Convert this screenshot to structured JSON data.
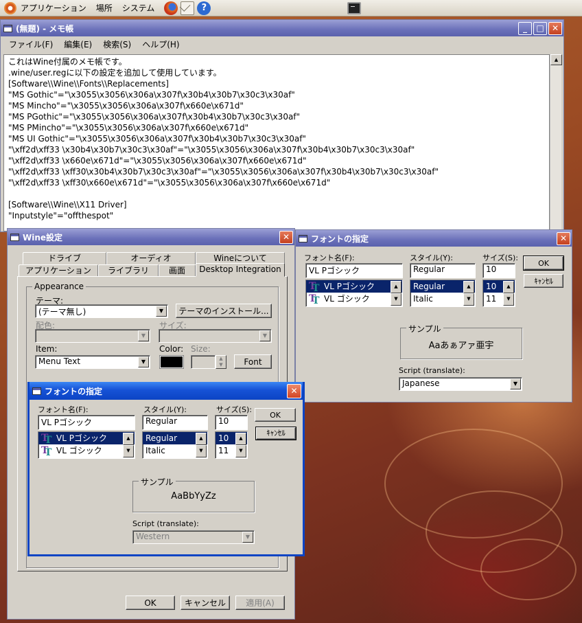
{
  "panel": {
    "menus": [
      "アプリケーション",
      "場所",
      "システム"
    ]
  },
  "notepad": {
    "title": "(無題) - メモ帳",
    "menus": [
      "ファイル(F)",
      "編集(E)",
      "検索(S)",
      "ヘルプ(H)"
    ],
    "lines": [
      "これはWine付属のメモ帳です。",
      ".wine/user.regに以下の設定を追加して使用しています。",
      "[Software\\\\Wine\\\\Fonts\\\\Replacements]",
      "\"MS Gothic\"=\"\\x3055\\x3056\\x306a\\x307f\\x30b4\\x30b7\\x30c3\\x30af\"",
      "\"MS Mincho\"=\"\\x3055\\x3056\\x306a\\x307f\\x660e\\x671d\"",
      "\"MS PGothic\"=\"\\x3055\\x3056\\x306a\\x307f\\x30b4\\x30b7\\x30c3\\x30af\"",
      "\"MS PMincho\"=\"\\x3055\\x3056\\x306a\\x307f\\x660e\\x671d\"",
      "\"MS UI Gothic\"=\"\\x3055\\x3056\\x306a\\x307f\\x30b4\\x30b7\\x30c3\\x30af\"",
      "\"\\xff2d\\xff33 \\x30b4\\x30b7\\x30c3\\x30af\"=\"\\x3055\\x3056\\x306a\\x307f\\x30b4\\x30b7\\x30c3\\x30af\"",
      "\"\\xff2d\\xff33 \\x660e\\x671d\"=\"\\x3055\\x3056\\x306a\\x307f\\x660e\\x671d\"",
      "\"\\xff2d\\xff33 \\xff30\\x30b4\\x30b7\\x30c3\\x30af\"=\"\\x3055\\x3056\\x306a\\x307f\\x30b4\\x30b7\\x30c3\\x30af\"",
      "\"\\xff2d\\xff33 \\xff30\\x660e\\x671d\"=\"\\x3055\\x3056\\x306a\\x307f\\x660e\\x671d\"",
      "",
      "[Software\\\\Wine\\\\X11 Driver]",
      "\"Inputstyle\"=\"offthespot\""
    ]
  },
  "winecfg": {
    "title": "Wine設定",
    "tabs_top": [
      "ドライブ",
      "オーディオ",
      "Wineについて"
    ],
    "tabs_bottom": [
      "アプリケーション",
      "ライブラリ",
      "画面",
      "Desktop Integration"
    ],
    "appearance_label": "Appearance",
    "theme_label": "テーマ:",
    "theme_value": "(テーマ無し)",
    "install_theme": "テーマのインストール...",
    "color_scheme_label": "配色:",
    "size_label": "サイズ:",
    "item_label": "Item:",
    "item_value": "Menu Text",
    "color_label": "Color:",
    "size2_label": "Size:",
    "font_button": "Font",
    "ok": "OK",
    "cancel": "キャンセル",
    "apply": "適用(A)"
  },
  "font_dialog_right": {
    "title": "フォントの指定",
    "font_name_label": "フォント名(F):",
    "style_label": "スタイル(Y):",
    "size_label": "サイズ(S):",
    "font_value": "VL Pゴシック",
    "style_value": "Regular",
    "size_value": "10",
    "fonts": [
      "VL Pゴシック",
      "VL ゴシック"
    ],
    "styles": [
      "Regular",
      "Italic"
    ],
    "sizes": [
      "10",
      "11"
    ],
    "ok": "OK",
    "cancel": "ｷｬﾝｾﾙ",
    "sample_label": "サンプル",
    "sample_text": "Aaあぁアァ亜宇",
    "script_label": "Script (translate):",
    "script_value": "Japanese"
  },
  "font_dialog_left": {
    "title": "フォントの指定",
    "font_name_label": "フォント名(F):",
    "style_label": "スタイル(Y):",
    "size_label": "サイズ(S):",
    "font_value": "VL Pゴシック",
    "style_value": "Regular",
    "size_value": "10",
    "fonts": [
      "VL Pゴシック",
      "VL ゴシック"
    ],
    "styles": [
      "Regular",
      "Italic"
    ],
    "sizes": [
      "10",
      "11"
    ],
    "ok": "OK",
    "cancel": "ｷｬﾝｾﾙ",
    "sample_label": "サンプル",
    "sample_text": "AaBbYyZz",
    "script_label": "Script (translate):",
    "script_value": "Western"
  }
}
